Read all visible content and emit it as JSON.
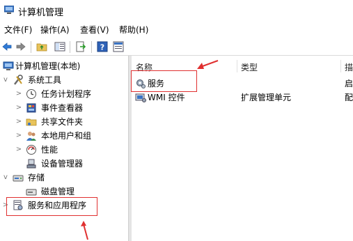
{
  "window": {
    "title": "计算机管理"
  },
  "menu": [
    "文件(F)",
    "操作(A)",
    "查看(V)",
    "帮助(H)"
  ],
  "toolbar": {
    "buttons": [
      "back-arrow-icon",
      "forward-arrow-icon",
      "up-folder-icon",
      "show-tree-icon",
      "export-list-icon",
      "help-icon",
      "properties-icon"
    ]
  },
  "tree": {
    "root": "计算机管理(本地)",
    "system_tools": "系统工具",
    "task_scheduler": "任务计划程序",
    "event_viewer": "事件查看器",
    "shared_folders": "共享文件夹",
    "local_users": "本地用户和组",
    "performance": "性能",
    "device_manager": "设备管理器",
    "storage": "存储",
    "disk_management": "磁盘管理",
    "services_apps": "服务和应用程序"
  },
  "list": {
    "headers": [
      "名称",
      "类型",
      "描"
    ],
    "rows": [
      {
        "name": "服务",
        "type": "",
        "desc": "启"
      },
      {
        "name": "WMI 控件",
        "type": "扩展管理单元",
        "desc": "配"
      }
    ]
  },
  "colors": {
    "highlight": "#e03030",
    "selection_bg": "#ffffff"
  }
}
